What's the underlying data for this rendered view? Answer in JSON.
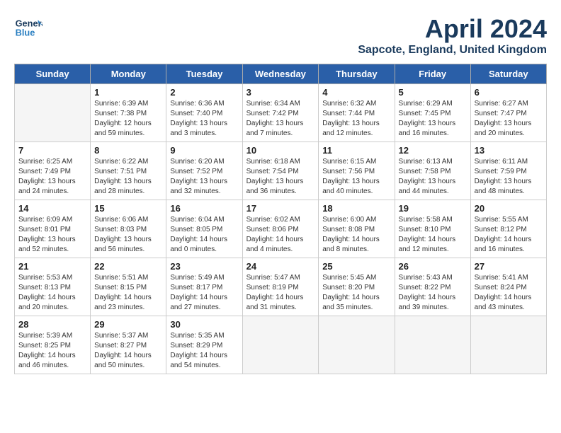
{
  "header": {
    "logo_line1": "General",
    "logo_line2": "Blue",
    "month": "April 2024",
    "location": "Sapcote, England, United Kingdom"
  },
  "days_of_week": [
    "Sunday",
    "Monday",
    "Tuesday",
    "Wednesday",
    "Thursday",
    "Friday",
    "Saturday"
  ],
  "weeks": [
    [
      {
        "num": "",
        "info": "",
        "empty": true
      },
      {
        "num": "1",
        "info": "Sunrise: 6:39 AM\nSunset: 7:38 PM\nDaylight: 12 hours\nand 59 minutes."
      },
      {
        "num": "2",
        "info": "Sunrise: 6:36 AM\nSunset: 7:40 PM\nDaylight: 13 hours\nand 3 minutes."
      },
      {
        "num": "3",
        "info": "Sunrise: 6:34 AM\nSunset: 7:42 PM\nDaylight: 13 hours\nand 7 minutes."
      },
      {
        "num": "4",
        "info": "Sunrise: 6:32 AM\nSunset: 7:44 PM\nDaylight: 13 hours\nand 12 minutes."
      },
      {
        "num": "5",
        "info": "Sunrise: 6:29 AM\nSunset: 7:45 PM\nDaylight: 13 hours\nand 16 minutes."
      },
      {
        "num": "6",
        "info": "Sunrise: 6:27 AM\nSunset: 7:47 PM\nDaylight: 13 hours\nand 20 minutes."
      }
    ],
    [
      {
        "num": "7",
        "info": "Sunrise: 6:25 AM\nSunset: 7:49 PM\nDaylight: 13 hours\nand 24 minutes."
      },
      {
        "num": "8",
        "info": "Sunrise: 6:22 AM\nSunset: 7:51 PM\nDaylight: 13 hours\nand 28 minutes."
      },
      {
        "num": "9",
        "info": "Sunrise: 6:20 AM\nSunset: 7:52 PM\nDaylight: 13 hours\nand 32 minutes."
      },
      {
        "num": "10",
        "info": "Sunrise: 6:18 AM\nSunset: 7:54 PM\nDaylight: 13 hours\nand 36 minutes."
      },
      {
        "num": "11",
        "info": "Sunrise: 6:15 AM\nSunset: 7:56 PM\nDaylight: 13 hours\nand 40 minutes."
      },
      {
        "num": "12",
        "info": "Sunrise: 6:13 AM\nSunset: 7:58 PM\nDaylight: 13 hours\nand 44 minutes."
      },
      {
        "num": "13",
        "info": "Sunrise: 6:11 AM\nSunset: 7:59 PM\nDaylight: 13 hours\nand 48 minutes."
      }
    ],
    [
      {
        "num": "14",
        "info": "Sunrise: 6:09 AM\nSunset: 8:01 PM\nDaylight: 13 hours\nand 52 minutes."
      },
      {
        "num": "15",
        "info": "Sunrise: 6:06 AM\nSunset: 8:03 PM\nDaylight: 13 hours\nand 56 minutes."
      },
      {
        "num": "16",
        "info": "Sunrise: 6:04 AM\nSunset: 8:05 PM\nDaylight: 14 hours\nand 0 minutes."
      },
      {
        "num": "17",
        "info": "Sunrise: 6:02 AM\nSunset: 8:06 PM\nDaylight: 14 hours\nand 4 minutes."
      },
      {
        "num": "18",
        "info": "Sunrise: 6:00 AM\nSunset: 8:08 PM\nDaylight: 14 hours\nand 8 minutes."
      },
      {
        "num": "19",
        "info": "Sunrise: 5:58 AM\nSunset: 8:10 PM\nDaylight: 14 hours\nand 12 minutes."
      },
      {
        "num": "20",
        "info": "Sunrise: 5:55 AM\nSunset: 8:12 PM\nDaylight: 14 hours\nand 16 minutes."
      }
    ],
    [
      {
        "num": "21",
        "info": "Sunrise: 5:53 AM\nSunset: 8:13 PM\nDaylight: 14 hours\nand 20 minutes."
      },
      {
        "num": "22",
        "info": "Sunrise: 5:51 AM\nSunset: 8:15 PM\nDaylight: 14 hours\nand 23 minutes."
      },
      {
        "num": "23",
        "info": "Sunrise: 5:49 AM\nSunset: 8:17 PM\nDaylight: 14 hours\nand 27 minutes."
      },
      {
        "num": "24",
        "info": "Sunrise: 5:47 AM\nSunset: 8:19 PM\nDaylight: 14 hours\nand 31 minutes."
      },
      {
        "num": "25",
        "info": "Sunrise: 5:45 AM\nSunset: 8:20 PM\nDaylight: 14 hours\nand 35 minutes."
      },
      {
        "num": "26",
        "info": "Sunrise: 5:43 AM\nSunset: 8:22 PM\nDaylight: 14 hours\nand 39 minutes."
      },
      {
        "num": "27",
        "info": "Sunrise: 5:41 AM\nSunset: 8:24 PM\nDaylight: 14 hours\nand 43 minutes."
      }
    ],
    [
      {
        "num": "28",
        "info": "Sunrise: 5:39 AM\nSunset: 8:25 PM\nDaylight: 14 hours\nand 46 minutes."
      },
      {
        "num": "29",
        "info": "Sunrise: 5:37 AM\nSunset: 8:27 PM\nDaylight: 14 hours\nand 50 minutes."
      },
      {
        "num": "30",
        "info": "Sunrise: 5:35 AM\nSunset: 8:29 PM\nDaylight: 14 hours\nand 54 minutes."
      },
      {
        "num": "",
        "info": "",
        "empty": true
      },
      {
        "num": "",
        "info": "",
        "empty": true
      },
      {
        "num": "",
        "info": "",
        "empty": true
      },
      {
        "num": "",
        "info": "",
        "empty": true
      }
    ]
  ]
}
